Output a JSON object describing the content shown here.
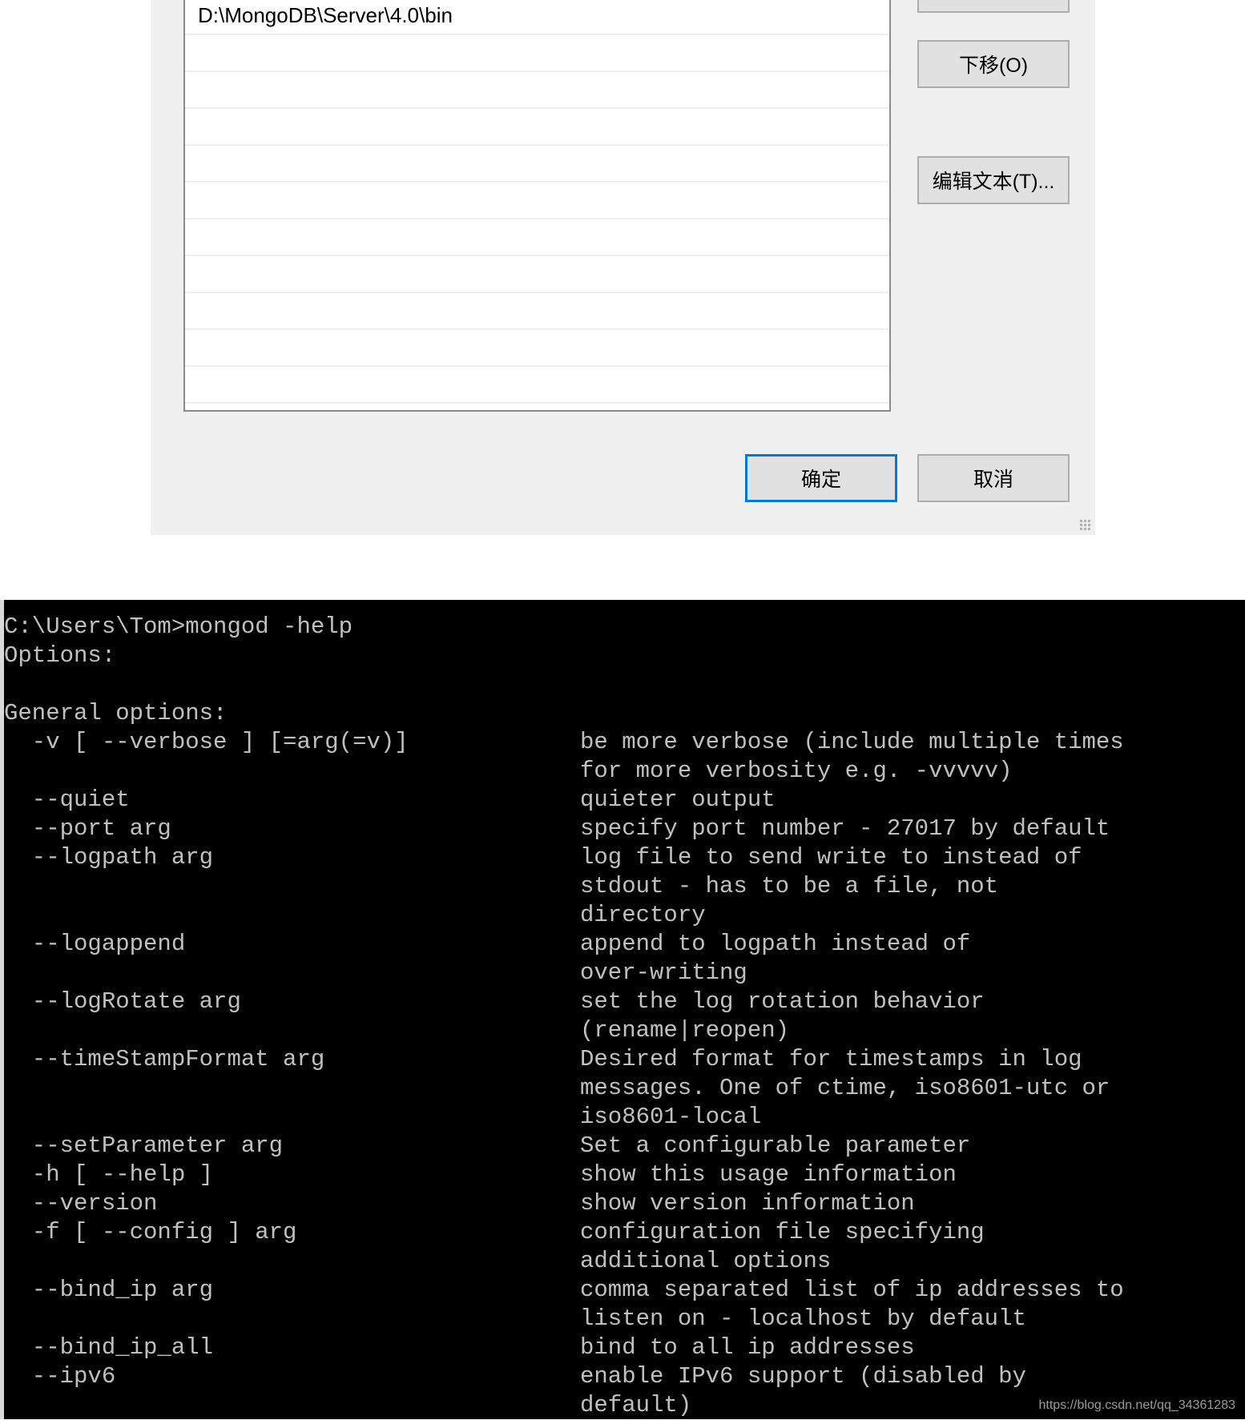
{
  "dialog": {
    "path_list": [
      "D:\\MongoDB\\Server\\4.0\\bin",
      "",
      "",
      "",
      "",
      "",
      "",
      "",
      "",
      "",
      ""
    ],
    "buttons": {
      "move_down": "下移(O)",
      "edit_text": "编辑文本(T)...",
      "ok": "确定",
      "cancel": "取消"
    },
    "accent_color": "#0078d7"
  },
  "terminal": {
    "lines": [
      {
        "opt": "C:\\Users\\Tom>mongod -help",
        "desc": ""
      },
      {
        "opt": "Options:",
        "desc": ""
      },
      {
        "opt": "",
        "desc": ""
      },
      {
        "opt": "General options:",
        "desc": ""
      },
      {
        "opt": "  -v [ --verbose ] [=arg(=v)]",
        "desc": "be more verbose (include multiple times"
      },
      {
        "opt": "",
        "desc": "for more verbosity e.g. -vvvvv)"
      },
      {
        "opt": "  --quiet",
        "desc": "quieter output"
      },
      {
        "opt": "  --port arg",
        "desc": "specify port number - 27017 by default"
      },
      {
        "opt": "  --logpath arg",
        "desc": "log file to send write to instead of"
      },
      {
        "opt": "",
        "desc": "stdout - has to be a file, not"
      },
      {
        "opt": "",
        "desc": "directory"
      },
      {
        "opt": "  --logappend",
        "desc": "append to logpath instead of"
      },
      {
        "opt": "",
        "desc": "over-writing"
      },
      {
        "opt": "  --logRotate arg",
        "desc": "set the log rotation behavior"
      },
      {
        "opt": "",
        "desc": "(rename|reopen)"
      },
      {
        "opt": "  --timeStampFormat arg",
        "desc": "Desired format for timestamps in log"
      },
      {
        "opt": "",
        "desc": "messages. One of ctime, iso8601-utc or"
      },
      {
        "opt": "",
        "desc": "iso8601-local"
      },
      {
        "opt": "  --setParameter arg",
        "desc": "Set a configurable parameter"
      },
      {
        "opt": "  -h [ --help ]",
        "desc": "show this usage information"
      },
      {
        "opt": "  --version",
        "desc": "show version information"
      },
      {
        "opt": "  -f [ --config ] arg",
        "desc": "configuration file specifying"
      },
      {
        "opt": "",
        "desc": "additional options"
      },
      {
        "opt": "  --bind_ip arg",
        "desc": "comma separated list of ip addresses to"
      },
      {
        "opt": "",
        "desc": "listen on - localhost by default"
      },
      {
        "opt": "  --bind_ip_all",
        "desc": "bind to all ip addresses"
      },
      {
        "opt": "  --ipv6",
        "desc": "enable IPv6 support (disabled by"
      },
      {
        "opt": "",
        "desc": "default)"
      }
    ]
  },
  "watermark": "https://blog.csdn.net/qq_34361283"
}
